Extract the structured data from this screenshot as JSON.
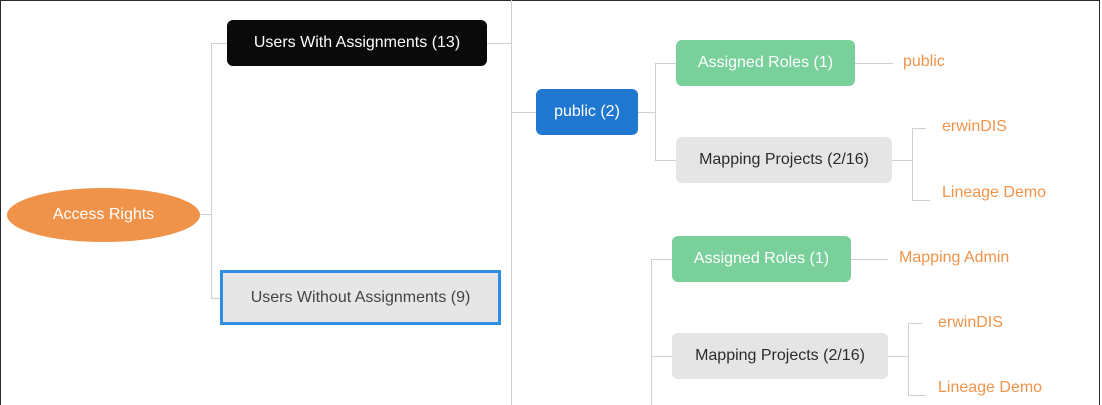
{
  "tree": {
    "root": "Access Rights",
    "with_assignments": "Users With Assignments (13)",
    "without_assignments": "Users Without Assignments (9)",
    "public": "public (2)",
    "group1": {
      "roles": "Assigned Roles (1)",
      "role_leaf": "public",
      "projects": "Mapping Projects (2/16)",
      "project_leaves": [
        "erwinDIS",
        "Lineage Demo"
      ]
    },
    "group2": {
      "roles": "Assigned Roles (1)",
      "role_leaf": "Mapping Admin",
      "projects": "Mapping Projects (2/16)",
      "project_leaves": [
        "erwinDIS",
        "Lineage Demo"
      ]
    }
  },
  "colors": {
    "root": "#F0934A",
    "with_assignments": "#0A0A0A",
    "public": "#1F77D0",
    "roles": "#79D09A",
    "projects": "#E5E5E5",
    "selection_border": "#2F8EE0",
    "leaf_text": "#F0934A"
  }
}
